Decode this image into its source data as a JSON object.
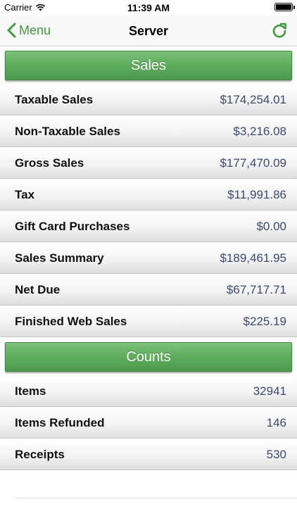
{
  "status_bar": {
    "carrier": "Carrier",
    "time": "11:39 AM"
  },
  "nav": {
    "back_label": "Menu",
    "title": "Server",
    "accent_color": "#3e9b3e"
  },
  "sales": {
    "header": "Sales",
    "rows": [
      {
        "label": "Taxable Sales",
        "value": "$174,254.01"
      },
      {
        "label": "Non-Taxable Sales",
        "value": "$3,216.08"
      },
      {
        "label": "Gross Sales",
        "value": "$177,470.09"
      },
      {
        "label": "Tax",
        "value": "$11,991.86"
      },
      {
        "label": "Gift Card Purchases",
        "value": "$0.00"
      },
      {
        "label": "Sales Summary",
        "value": "$189,461.95"
      },
      {
        "label": "Net Due",
        "value": "$67,717.71"
      },
      {
        "label": "Finished Web Sales",
        "value": "$225.19"
      }
    ]
  },
  "counts": {
    "header": "Counts",
    "rows": [
      {
        "label": "Items",
        "value": "32941"
      },
      {
        "label": "Items Refunded",
        "value": "146"
      },
      {
        "label": "Receipts",
        "value": "530"
      }
    ]
  },
  "colors": {
    "header_green": "#5fae5e",
    "value_text": "#3a4a72"
  }
}
